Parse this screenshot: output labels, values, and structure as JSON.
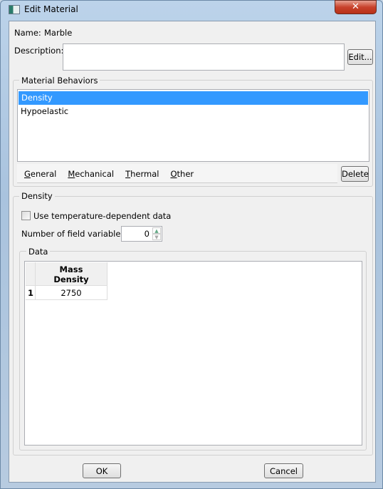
{
  "window": {
    "title": "Edit Material",
    "close_glyph": "✕"
  },
  "name": {
    "label": "Name:",
    "value": "Marble"
  },
  "description": {
    "label": "Description:",
    "value": "",
    "edit_button": "Edit..."
  },
  "behaviors": {
    "legend": "Material Behaviors",
    "items": [
      "Density",
      "Hypoelastic"
    ],
    "selected": "Density",
    "menus": [
      {
        "first": "G",
        "rest": "eneral"
      },
      {
        "first": "M",
        "rest": "echanical"
      },
      {
        "first": "T",
        "rest": "hermal"
      },
      {
        "first": "O",
        "rest": "ther"
      }
    ],
    "delete_button": "Delete"
  },
  "density": {
    "legend": "Density",
    "temp_dependent_label": "Use temperature-dependent data",
    "temp_dependent_checked": false,
    "field_vars_label": "Number of field variables:",
    "field_vars_value": "0",
    "data": {
      "legend": "Data",
      "columns": [
        "Mass\nDensity"
      ],
      "rows": [
        {
          "index": "1",
          "values": [
            "2750"
          ]
        }
      ]
    }
  },
  "footer": {
    "ok": "OK",
    "cancel": "Cancel"
  },
  "colors": {
    "selection": "#3399ff"
  }
}
